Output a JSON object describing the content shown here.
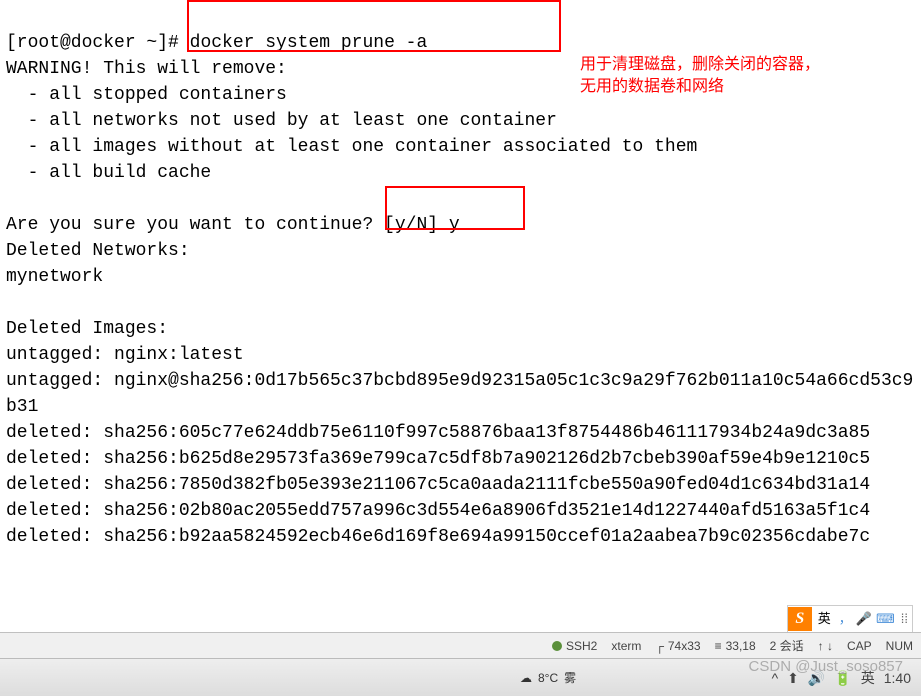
{
  "terminal": {
    "prompt": "[root@docker ~]# ",
    "command": "docker system prune -a",
    "warning": "WARNING! This will remove:",
    "bullets": [
      "  - all stopped containers",
      "  - all networks not used by at least one container",
      "  - all images without at least one container associated to them",
      "  - all build cache"
    ],
    "confirm_q": "Are you sure you want to continue? [y/N] ",
    "confirm_ans": "y",
    "deleted_networks_header": "Deleted Networks:",
    "deleted_networks": [
      "mynetwork"
    ],
    "deleted_images_header": "Deleted Images:",
    "deleted_images": [
      "untagged: nginx:latest",
      "untagged: nginx@sha256:0d17b565c37bcbd895e9d92315a05c1c3c9a29f762b011a10c54a66cd53c9b31",
      "deleted: sha256:605c77e624ddb75e6110f997c58876baa13f8754486b461117934b24a9dc3a85",
      "deleted: sha256:b625d8e29573fa369e799ca7c5df8b7a902126d2b7cbeb390af59e4b9e1210c5",
      "deleted: sha256:7850d382fb05e393e211067c5ca0aada2111fcbe550a90fed04d1c634bd31a14",
      "deleted: sha256:02b80ac2055edd757a996c3d554e6a8906fd3521e14d1227440afd5163a5f1c4",
      "deleted: sha256:b92aa5824592ecb46e6d169f8e694a99150ccef01a2aabea7b9c02356cdabe7c"
    ]
  },
  "annotation": "用于清理磁盘，删除关闭的容器，\n无用的数据卷和网络",
  "ime": {
    "logo": "S",
    "lang": "英",
    "icons": {
      "comma": "，",
      "mic": "🎤",
      "keyboard": "⌨",
      "grid": "⁞⁞"
    }
  },
  "statusbar": {
    "ssh": "SSH2",
    "term": "xterm",
    "size": "74x33",
    "cursor": "33,18",
    "sessions": "2 会话",
    "cap": "CAP",
    "num": "NUM",
    "arrows": "↑ ↓"
  },
  "taskbar": {
    "weather_temp": "8°C",
    "weather_desc": "雾",
    "tray": {
      "arrow": "^",
      "net": "⬆",
      "vol": "🔊",
      "bat": "🔋",
      "lang": "英",
      "time": "1:40"
    }
  },
  "watermark": "CSDN @Just_soso857"
}
